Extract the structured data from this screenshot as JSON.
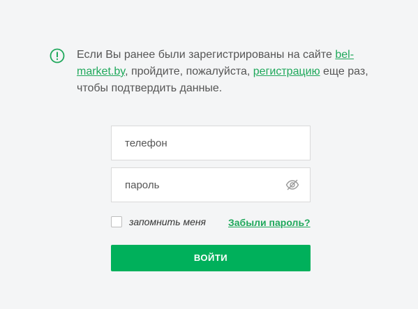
{
  "notice": {
    "icon": "exclamation-circle-icon",
    "text_part1": "Если Вы ранее были зарегистрированы на сайте ",
    "link_site": "bel-market.by",
    "text_part2": ", пройдите, пожалуйста, ",
    "link_register": "регистрацию",
    "text_part3": " еще раз, чтобы подтвердить данные."
  },
  "form": {
    "phone_placeholder": "телефон",
    "phone_value": "",
    "password_placeholder": "пароль",
    "password_value": "",
    "password_toggle_icon": "eye-slash-icon",
    "remember_label": "запомнить меня",
    "remember_checked": false,
    "forgot_label": "Забыли пароль?",
    "submit_label": "ВОЙТИ"
  },
  "colors": {
    "accent": "#00b05b",
    "link": "#1fa85b",
    "background": "#f4f5f6",
    "text": "#555555"
  }
}
